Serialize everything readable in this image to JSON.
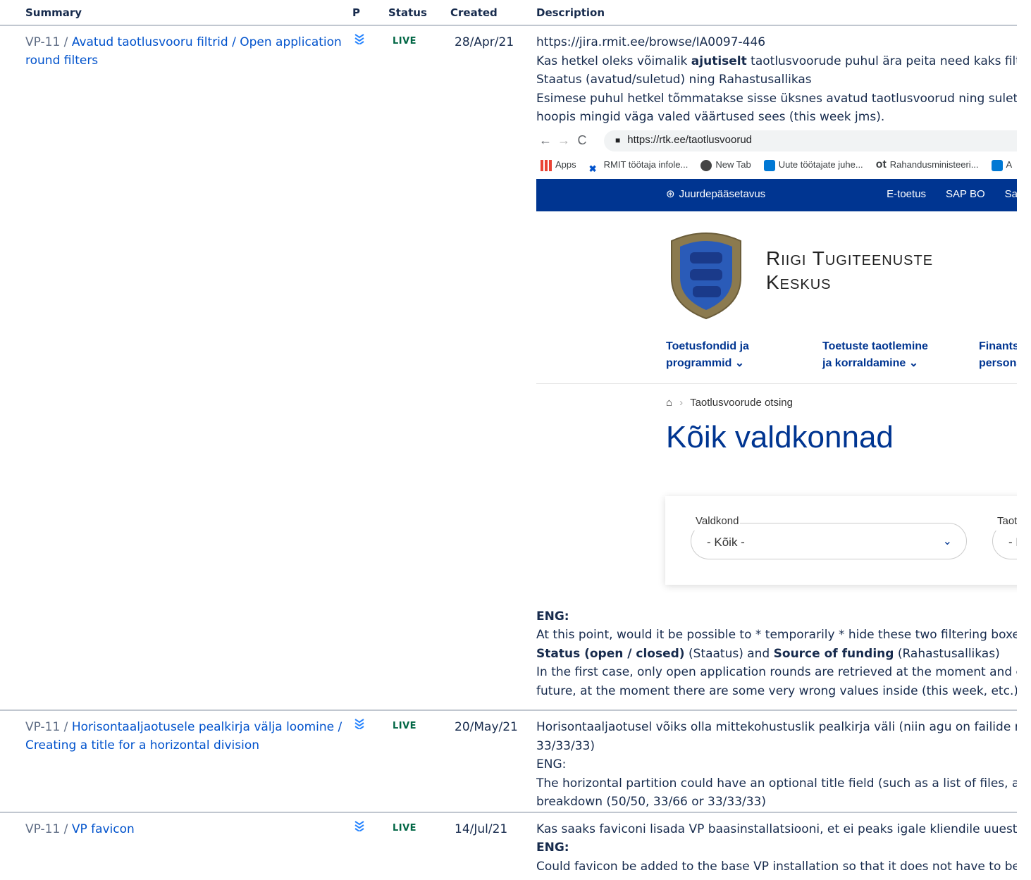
{
  "columns": {
    "summary": "Summary",
    "priority": "P",
    "status": "Status",
    "created": "Created",
    "description": "Description"
  },
  "rows": [
    {
      "key": "VP-11 /",
      "summary": "Avatud taotlusvooru filtrid / Open application round filters",
      "status": "LIVE",
      "created": "28/Apr/21",
      "desc_lines": [
        "https://jira.rmit.ee/browse/IA0097-446"
      ],
      "desc_l2_pre": "Kas hetkel oleks võimalik ",
      "desc_l2_bold": "ajutiselt",
      "desc_l2_post": " taotlusvoorude puhul ära peita need kaks filtreerin",
      "desc_l3": "Staatus (avatud/suletud) ning Rahastusallikas",
      "desc_l4": "Esimese puhul hetkel tõmmatakse sisse üksnes avatud taotlusvoorud ning suletuid ei",
      "desc_l5": "hoopis mingid väga valed väärtused sees (this week jms).",
      "screenshot": {
        "url": "https://rtk.ee/taotlusvoorud",
        "bookmarks": [
          "Apps",
          "RMIT töötaja infole...",
          "New Tab",
          "Uute töötajate juhe...",
          "Rahandusministeeri...",
          "A"
        ],
        "topbar": [
          "Juurdepääsetavus",
          "E-toetus",
          "SAP BO",
          "Saldoan"
        ],
        "org_line1": "Riigi Tugiteenuste",
        "org_line2": "Keskus",
        "menu": [
          [
            "Toetusfondid ja",
            "programmid ⌄"
          ],
          [
            "Toetuste taotlemine",
            "ja korraldamine ⌄"
          ],
          [
            "Finantsarves",
            "personalitee"
          ]
        ],
        "crumb": "Taotlusvoorude otsing",
        "title": "Kõik valdkonnad",
        "filter1_label": "Valdkond",
        "filter1_value": "- Kõik -",
        "filter2_label": "Taotleja vo",
        "filter2_value": "- Kõik -"
      },
      "eng_label": "ENG:",
      "eng_l1": "At this point, would it be possible to * temporarily * hide these two filtering boxes fo",
      "eng_l2_b1": "Status (open / closed)",
      "eng_l2_t1": " (Staatus) and ",
      "eng_l2_b2": "Source of funding",
      "eng_l2_t2": " (Rahastusallikas)",
      "eng_l3": "In the first case, only open application rounds are retrieved at the moment and close",
      "eng_l4": "future, at the moment there are some very wrong values inside (this week, etc.)."
    },
    {
      "key": "VP-11 /",
      "summary": "Horisontaaljaotusele pealkirja välja loomine / Creating a title for a horizontal division",
      "status": "LIVE",
      "created": "20/May/21",
      "l1": "Horisontaaljaotusel võiks olla mittekohustuslik pealkirja väli (niin agu on failide nimel",
      "l2": "33/33/33)",
      "l3": "ENG:",
      "l4": "The horizontal partition could have an optional title field (such as a list of files, an acc",
      "l5": "breakdown (50/50, 33/66 or 33/33/33)"
    },
    {
      "key": "VP-11 /",
      "summary": "VP favicon",
      "status": "LIVE",
      "created": "14/Jul/21",
      "l1": "Kas saaks faviconi lisada VP baasinstallatsiooni, et ei peaks igale kliendile uuesti lisam",
      "l2": "ENG:",
      "l3": "Could favicon be added to the base VP installation so that it does not have to be adc"
    }
  ]
}
